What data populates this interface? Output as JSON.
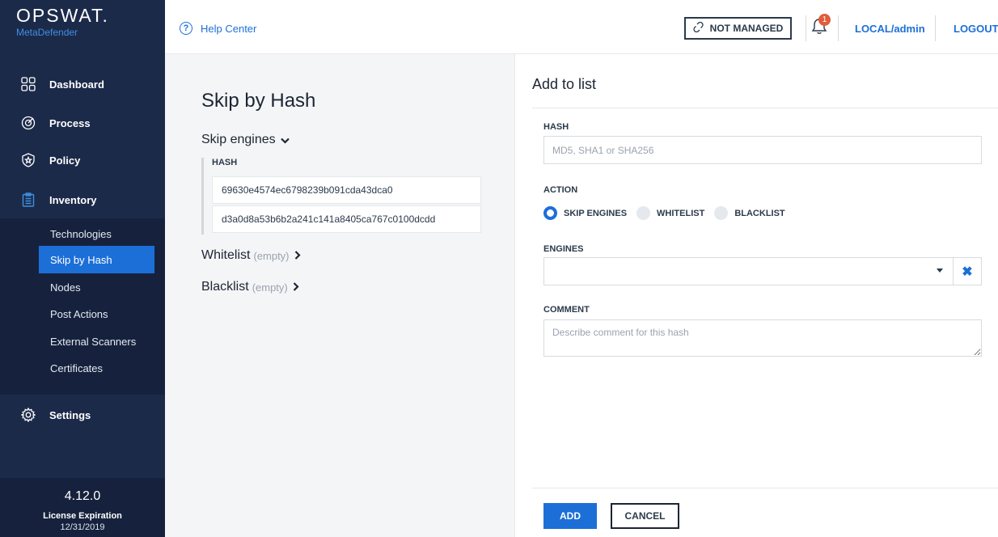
{
  "brand": {
    "name": "OPSWAT.",
    "product": "MetaDefender"
  },
  "sidebar": {
    "items": [
      {
        "label": "Dashboard",
        "icon": "dashboard-icon"
      },
      {
        "label": "Process",
        "icon": "process-icon"
      },
      {
        "label": "Policy",
        "icon": "policy-icon"
      },
      {
        "label": "Inventory",
        "icon": "inventory-icon"
      },
      {
        "label": "Settings",
        "icon": "settings-icon"
      }
    ],
    "subitems": [
      "Technologies",
      "Skip by Hash",
      "Nodes",
      "Post Actions",
      "External Scanners",
      "Certificates"
    ],
    "active_subitem": "Skip by Hash"
  },
  "footer": {
    "version": "4.12.0",
    "license_label": "License Expiration",
    "license_date": "12/31/2019"
  },
  "header": {
    "help": "Help Center",
    "not_managed": "NOT MANAGED",
    "notification_count": "1",
    "user": "LOCAL/admin",
    "logout": "LOGOUT"
  },
  "skip": {
    "title": "Skip by Hash",
    "skip_engines": "Skip engines",
    "hash_header": "HASH",
    "hashes": [
      "69630e4574ec6798239b091cda43dca0",
      "d3a0d8a53b6b2a241c141a8405ca767c0100dcdd"
    ],
    "whitelist": "Whitelist",
    "blacklist": "Blacklist",
    "empty_label": "(empty)"
  },
  "form": {
    "title": "Add to list",
    "hash_label": "HASH",
    "hash_placeholder": "MD5, SHA1 or SHA256",
    "action_label": "ACTION",
    "actions": [
      {
        "label": "SKIP ENGINES",
        "selected": true
      },
      {
        "label": "WHITELIST",
        "selected": false
      },
      {
        "label": "BLACKLIST",
        "selected": false
      }
    ],
    "engines_label": "ENGINES",
    "comment_label": "COMMENT",
    "comment_placeholder": "Describe comment for this hash",
    "add_label": "ADD",
    "cancel_label": "CANCEL"
  },
  "colors": {
    "sidebar": "#1c2a4a",
    "accent": "#1d6fd8",
    "badge": "#e05d3b"
  }
}
